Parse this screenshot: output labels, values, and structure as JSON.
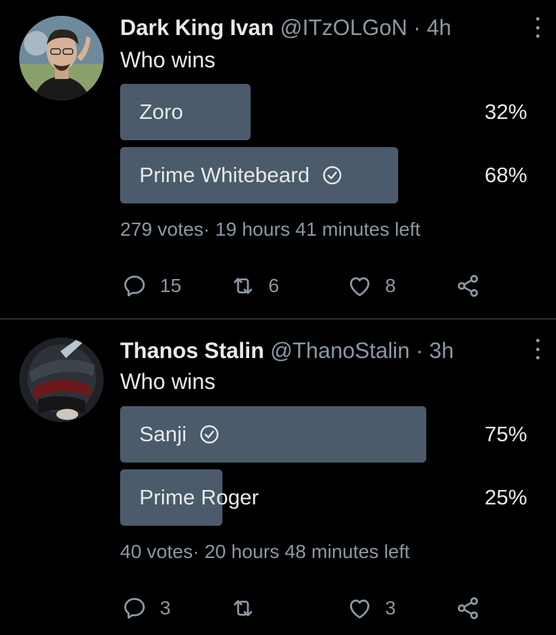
{
  "tweets": [
    {
      "display_name": "Dark King Ivan",
      "handle": "@ITzOLGoN",
      "separator": "·",
      "time": "4h",
      "text": "Who wins",
      "poll": {
        "options": [
          {
            "label": "Zoro",
            "percent": "32%",
            "share": 0.32,
            "winner": false
          },
          {
            "label": "Prime Whitebeard",
            "percent": "68%",
            "share": 0.68,
            "winner": true
          }
        ],
        "votes": "279 votes",
        "bullet": "·",
        "time_left": "19 hours 41 minutes left"
      },
      "actions": {
        "replies": "15",
        "retweets": "6",
        "likes": "8"
      }
    },
    {
      "display_name": "Thanos Stalin",
      "handle": "@ThanoStalin",
      "separator": "·",
      "time": "3h",
      "text": "Who wins",
      "poll": {
        "options": [
          {
            "label": "Sanji",
            "percent": "75%",
            "share": 0.75,
            "winner": true
          },
          {
            "label": "Prime Roger",
            "percent": "25%",
            "share": 0.25,
            "winner": false
          }
        ],
        "votes": "40 votes",
        "bullet": "·",
        "time_left": "20 hours 48 minutes left"
      },
      "actions": {
        "replies": "3",
        "retweets": "",
        "likes": "3"
      }
    }
  ],
  "colors": {
    "background": "#000000",
    "poll_fill": "#4b5b6b",
    "secondary_text": "#8b98a5",
    "primary_text": "#e7e9ea"
  },
  "icons": {
    "reply": "reply-icon",
    "retweet": "retweet-icon",
    "like": "heart-icon",
    "share": "share-icon",
    "winner": "check-circle-icon",
    "more": "more-vertical-icon"
  }
}
